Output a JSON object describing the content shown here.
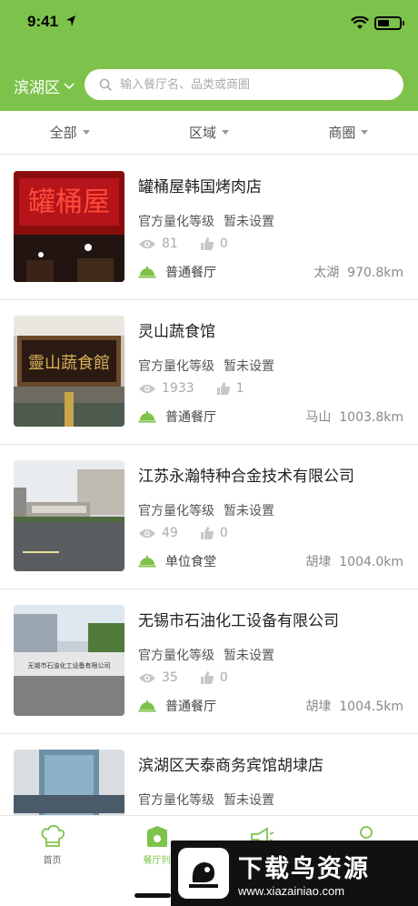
{
  "status": {
    "time": "9:41"
  },
  "header": {
    "district": "滨湖区",
    "search_placeholder": "输入餐厅名、品类或商圈"
  },
  "filters": [
    {
      "label": "全部"
    },
    {
      "label": "区域"
    },
    {
      "label": "商圈"
    }
  ],
  "labels": {
    "level_label": "官方量化等级"
  },
  "restaurants": [
    {
      "name": "罐桶屋韩国烤肉店",
      "level": "暂未设置",
      "views": "81",
      "likes": "0",
      "type": "普通餐厅",
      "area": "太湖",
      "distance": "970.8km"
    },
    {
      "name": "灵山蔬食馆",
      "level": "暂未设置",
      "views": "1933",
      "likes": "1",
      "type": "普通餐厅",
      "area": "马山",
      "distance": "1003.8km"
    },
    {
      "name": "江苏永瀚特种合金技术有限公司",
      "level": "暂未设置",
      "views": "49",
      "likes": "0",
      "type": "单位食堂",
      "area": "胡埭",
      "distance": "1004.0km"
    },
    {
      "name": "无锡市石油化工设备有限公司",
      "level": "暂未设置",
      "views": "35",
      "likes": "0",
      "type": "普通餐厅",
      "area": "胡埭",
      "distance": "1004.5km"
    },
    {
      "name": "滨湖区天泰商务宾馆胡埭店",
      "level": "暂未设置",
      "views": "",
      "likes": "",
      "type": "",
      "area": "",
      "distance": ""
    }
  ],
  "image_text": {
    "sign_1": "罐桶屋",
    "sign_2": "靈山蔬食館",
    "sign_4": "无锡市石油化工设备有限公司"
  },
  "tabs": [
    {
      "label": "首页",
      "icon": "chef-hat-icon"
    },
    {
      "label": "餐厅列",
      "icon": "restaurant-icon"
    },
    {
      "label": "",
      "icon": "megaphone-icon"
    },
    {
      "label": "",
      "icon": "user-icon"
    }
  ],
  "watermark": {
    "title": "下载鸟资源",
    "url": "www.xiazainiao.com"
  },
  "colors": {
    "brand_green": "#7dc24a"
  }
}
